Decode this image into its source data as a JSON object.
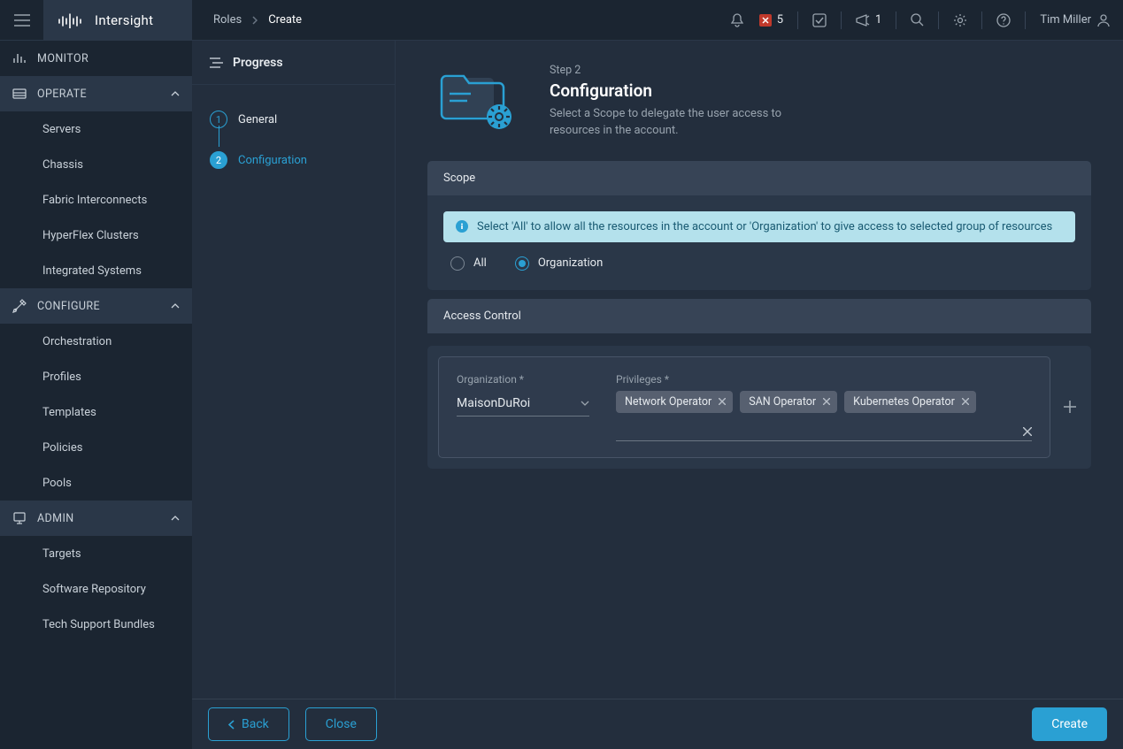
{
  "brand": "Intersight",
  "breadcrumb": {
    "root": "Roles",
    "current": "Create"
  },
  "topbar": {
    "alert_count": "5",
    "announce_count": "1",
    "user_name": "Tim Miller"
  },
  "leftnav": {
    "monitor": "MONITOR",
    "operate": {
      "label": "OPERATE",
      "items": [
        "Servers",
        "Chassis",
        "Fabric Interconnects",
        "HyperFlex Clusters",
        "Integrated Systems"
      ]
    },
    "configure": {
      "label": "CONFIGURE",
      "items": [
        "Orchestration",
        "Profiles",
        "Templates",
        "Policies",
        "Pools"
      ]
    },
    "admin": {
      "label": "ADMIN",
      "items": [
        "Targets",
        "Software Repository",
        "Tech Support Bundles"
      ]
    }
  },
  "progress": {
    "title": "Progress",
    "steps": [
      {
        "num": "1",
        "label": "General"
      },
      {
        "num": "2",
        "label": "Configuration"
      }
    ]
  },
  "page": {
    "step_tag": "Step 2",
    "title": "Configuration",
    "description": "Select a Scope to delegate the user access to resources in the account."
  },
  "scope": {
    "heading": "Scope",
    "info": "Select 'All' to allow all the resources in the account or 'Organization' to give access to selected group of resources",
    "option_all": "All",
    "option_org": "Organization"
  },
  "access_control": {
    "heading": "Access Control",
    "org_label": "Organization *",
    "org_value": "MaisonDuRoi",
    "priv_label": "Privileges *",
    "privileges": [
      "Network Operator",
      "SAN Operator",
      "Kubernetes Operator"
    ]
  },
  "footer": {
    "back": "Back",
    "close": "Close",
    "create": "Create"
  }
}
